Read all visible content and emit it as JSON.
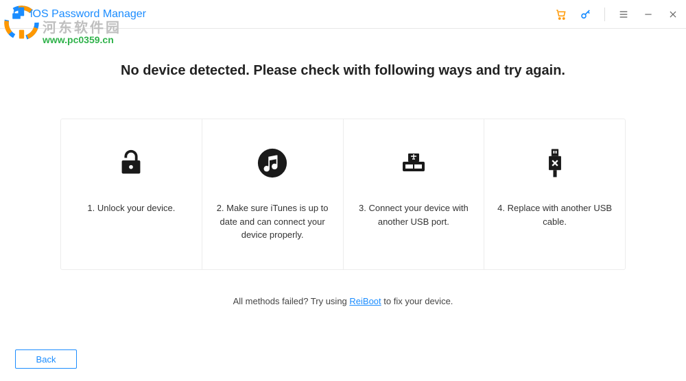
{
  "app": {
    "title": "iOS Password Manager"
  },
  "watermark": {
    "text1": "河东软件园",
    "text2": "www.pc0359.cn"
  },
  "headline": "No device detected. Please check with following ways and try again.",
  "cards": [
    {
      "text": "1. Unlock your device.",
      "icon": "lock-open-icon"
    },
    {
      "text": "2. Make sure iTunes is up to date and can connect your device properly.",
      "icon": "itunes-icon"
    },
    {
      "text": "3. Connect your device with another USB port.",
      "icon": "usb-port-icon"
    },
    {
      "text": "4. Replace with another USB cable.",
      "icon": "usb-cable-icon"
    }
  ],
  "footerHint": {
    "prefix": "All methods failed? Try using ",
    "linkText": "ReiBoot",
    "suffix": " to fix your device."
  },
  "buttons": {
    "back": "Back"
  }
}
